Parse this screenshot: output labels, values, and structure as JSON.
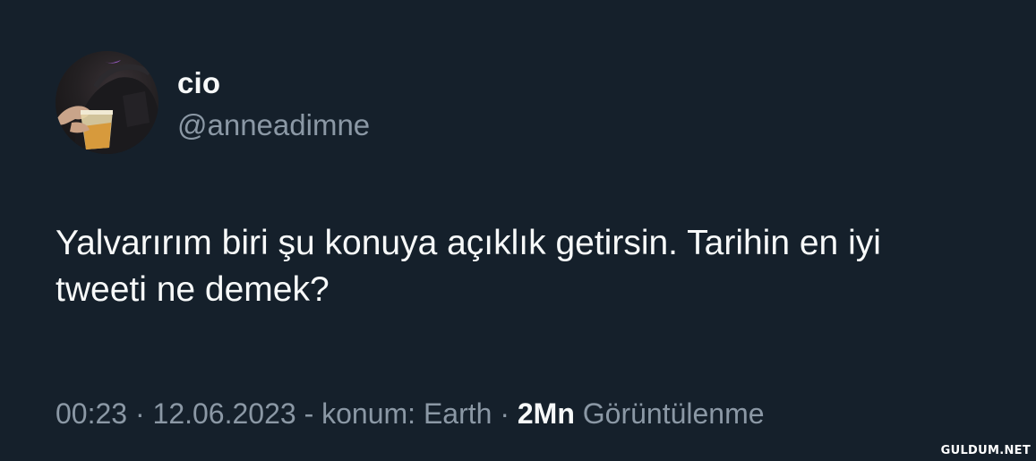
{
  "author": {
    "display_name": "cio",
    "handle": "@anneadimne"
  },
  "tweet": {
    "text_line_1": "Yalvarırım biri şu konuya açıklık getirsin. Tarihin en iyi",
    "text_line_2": "tweeti ne demek?"
  },
  "meta": {
    "time": "00:23",
    "separator_1": " · ",
    "date": "12.06.2023",
    "location": " - konum: Earth",
    "separator_2": " · ",
    "views_count": "2Mn",
    "views_label": " Görüntülenme"
  },
  "watermark": "GULDUM.NET",
  "colors": {
    "background": "#15202b",
    "primary_text": "#f7f9f9",
    "secondary_text": "#8b98a5"
  }
}
